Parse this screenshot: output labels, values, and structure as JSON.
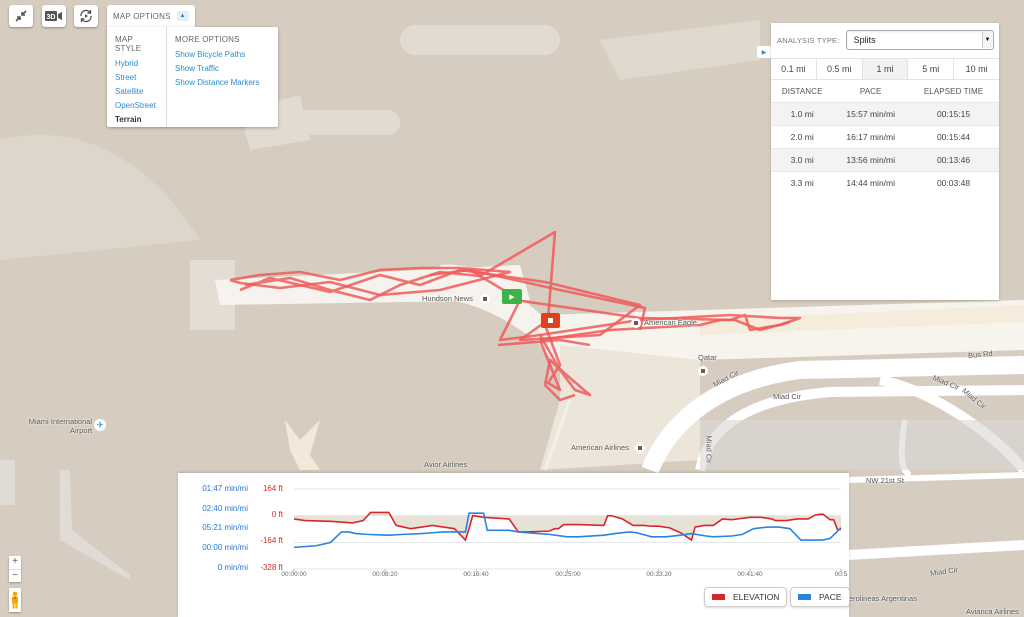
{
  "toolbar": {
    "buttons": [
      {
        "name": "exit-fullscreen",
        "icon": "collapse-arrows-icon"
      },
      {
        "name": "3d-view",
        "icon": "3d-camera-icon",
        "label": "3D"
      },
      {
        "name": "replay",
        "icon": "replay-icon"
      }
    ],
    "map_options_label": "MAP OPTIONS"
  },
  "map_options": {
    "style_heading": "MAP STYLE",
    "styles": [
      "Hybrid",
      "Street",
      "Satellite",
      "OpenStreet",
      "Terrain"
    ],
    "active_style": "Terrain",
    "more_heading": "MORE OPTIONS",
    "more": [
      "Show Bicycle Paths",
      "Show Traffic",
      "Show Distance Markers"
    ]
  },
  "analysis": {
    "type_label": "ANALYSIS TYPE:",
    "type_value": "Splits",
    "intervals": [
      "0.1 mi",
      "0.5 mi",
      "1 mi",
      "5 mi",
      "10 mi"
    ],
    "selected_interval": "1 mi",
    "columns": [
      "DISTANCE",
      "PACE",
      "ELAPSED TIME"
    ],
    "rows": [
      [
        "1.0 mi",
        "15:57 min/mi",
        "00:15:15"
      ],
      [
        "2.0 mi",
        "16:17 min/mi",
        "00:15:44"
      ],
      [
        "3.0 mi",
        "13:56 min/mi",
        "00:13:46"
      ],
      [
        "3.3 mi",
        "14:44 min/mi",
        "00:03:48"
      ]
    ]
  },
  "map_labels": {
    "airport": "Miami International Airport",
    "airport_line1": "Miami International",
    "airport_line2": "Airport",
    "hudson": "Hundson News",
    "american_eagle": "American Eagle",
    "qatar": "Qatar",
    "american_airlines": "American Airlines",
    "avior": "Avior Airlines",
    "miad1": "Miad Cir",
    "miad2": "Miad Cir",
    "miad3": "Miad Cir",
    "miad4": "Miad Cir",
    "miad5": "Miad Cir",
    "miad6": "Miad Cir",
    "bus_rd": "Bus Rd",
    "nw21": "NW 21st St",
    "aerolineas": "erolineas Argentinas",
    "avianca": "Avianca Airlines"
  },
  "zoom_controls": {
    "plus": "+",
    "minus": "−"
  },
  "chart_data": {
    "type": "line",
    "x_ticks": [
      "00:00:00",
      "00:08:20",
      "00:16:40",
      "00:25:00",
      "00:33:20",
      "00:41:40",
      "00:5"
    ],
    "x_range_seconds": [
      0,
      3000
    ],
    "y_left_pace_ticks": [
      "01:47 min/mi",
      "02:40 min/mi",
      "05:21 min/mi",
      "00:00 min/mi",
      "0 min/mi"
    ],
    "y_right_elevation_ticks": [
      "164 ft",
      "0 ft",
      "-164 ft",
      "-328 ft"
    ],
    "elevation_range_ft": [
      -328,
      164
    ],
    "series": [
      {
        "name": "ELEVATION",
        "color": "#d9262b",
        "unit": "ft",
        "x": [
          0,
          60,
          200,
          320,
          380,
          420,
          520,
          560,
          640,
          700,
          760,
          820,
          880,
          940,
          960,
          980,
          1040,
          1180,
          1230,
          1270,
          1400,
          1430,
          1450,
          1480,
          1560,
          1700,
          1720,
          1740,
          1800,
          1860,
          1920,
          1960,
          2000,
          2060,
          2120,
          2180,
          2200,
          2250,
          2300,
          2350,
          2400,
          2500,
          2560,
          2620,
          2640,
          2700,
          2760,
          2820,
          2860,
          2900,
          2940,
          2960,
          2980,
          3000
        ],
        "values": [
          -20,
          -30,
          -35,
          -45,
          -30,
          20,
          20,
          -60,
          -80,
          -70,
          -60,
          -70,
          -80,
          -150,
          -80,
          0,
          -10,
          -20,
          -100,
          -100,
          -95,
          -80,
          -80,
          -55,
          -55,
          -60,
          0,
          0,
          -20,
          -60,
          -60,
          -65,
          -65,
          -75,
          -105,
          -150,
          -70,
          -60,
          -60,
          -20,
          -25,
          -10,
          -10,
          -20,
          -30,
          -30,
          -20,
          -20,
          5,
          10,
          -25,
          -25,
          -85,
          -85
        ]
      },
      {
        "name": "PACE",
        "color": "#2a83e0",
        "unit": "min/mi (plotted on elevation scale, ft-equivalent)",
        "x": [
          0,
          120,
          200,
          260,
          300,
          340,
          400,
          520,
          600,
          700,
          760,
          820,
          880,
          940,
          960,
          1040,
          1060,
          1180,
          1230,
          1280,
          1340,
          1400,
          1500,
          1560,
          1700,
          1760,
          1840,
          1880,
          1960,
          2040,
          2120,
          2180,
          2260,
          2300,
          2400,
          2460,
          2520,
          2600,
          2660,
          2720,
          2780,
          2840,
          2900,
          2940,
          3000
        ],
        "values": [
          -195,
          -185,
          -165,
          -100,
          -100,
          -110,
          -115,
          -120,
          -115,
          -110,
          -105,
          -100,
          -100,
          -100,
          15,
          15,
          -90,
          -90,
          -100,
          -105,
          -110,
          -115,
          -130,
          -130,
          -120,
          -110,
          -100,
          -105,
          -130,
          -130,
          -120,
          -110,
          -125,
          -130,
          -125,
          -115,
          -80,
          -70,
          -70,
          -80,
          -150,
          -150,
          -150,
          -140,
          -75
        ]
      }
    ],
    "legend": [
      "ELEVATION",
      "PACE"
    ],
    "legend_position": "bottom-right",
    "baseline_fill": "area between elevation line and 0 ft shaded beige",
    "grid": true
  }
}
